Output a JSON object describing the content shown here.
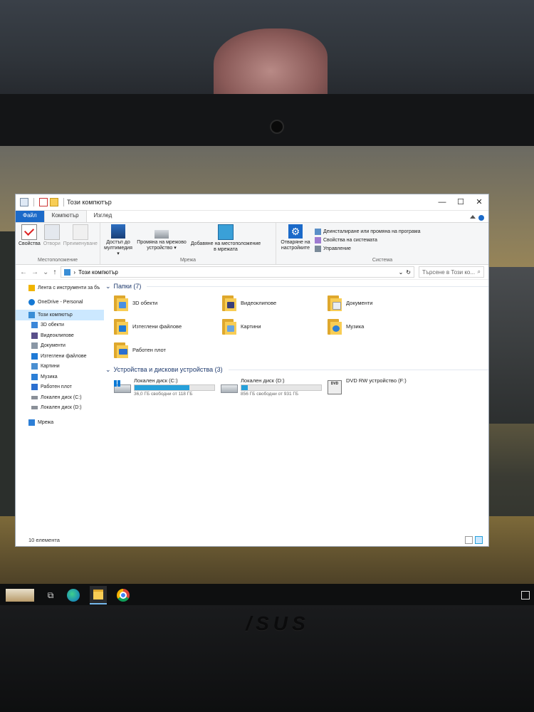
{
  "window": {
    "title": "Този компютър",
    "controls": {
      "minimize": "—",
      "maximize": "☐",
      "close": "✕"
    }
  },
  "tabs": [
    {
      "label": "Файл"
    },
    {
      "label": "Компютър"
    },
    {
      "label": "Изглед"
    }
  ],
  "ribbon": {
    "location_group": {
      "label": "Местоположение",
      "buttons": [
        "Свойства",
        "Отвори",
        "Преименуване"
      ]
    },
    "network_group": {
      "label": "Мрежа",
      "buttons": [
        "Достъп до мултимедия ▾",
        "Промяна на мрежово устройство ▾",
        "Добавяне на местоположение в мрежата"
      ]
    },
    "settings_button": "Отваряне на настройките",
    "system_group": {
      "label": "Система",
      "items": [
        "Деинсталиране или промяна на програма",
        "Свойства на системата",
        "Управление"
      ]
    }
  },
  "address": {
    "back": "←",
    "forward": "→",
    "recent": "⌄",
    "up": "↑",
    "path": "Този компютър",
    "refresh": "↻",
    "search_placeholder": "Търсене в Този ко..."
  },
  "nav_pane": [
    {
      "label": "Лента с инструменти за бъ",
      "icon": "star-icon",
      "color": "#f0b400"
    },
    {
      "label": "OneDrive - Personal",
      "icon": "cloud-icon",
      "color": "#1478d4"
    },
    {
      "label": "Този компютър",
      "icon": "computer-icon",
      "color": "#3a8ed6",
      "selected": true
    },
    {
      "label": "3D обекти",
      "icon": "cube-icon",
      "color": "#3b87d9"
    },
    {
      "label": "Видеоклипове",
      "icon": "video-icon",
      "color": "#5a4f8a"
    },
    {
      "label": "Документи",
      "icon": "document-icon",
      "color": "#8a97a6"
    },
    {
      "label": "Изтеглени файлове",
      "icon": "download-icon",
      "color": "#1f7ad6"
    },
    {
      "label": "Картини",
      "icon": "picture-icon",
      "color": "#4a8fd1"
    },
    {
      "label": "Музика",
      "icon": "music-icon",
      "color": "#2c7fd6"
    },
    {
      "label": "Работен плот",
      "icon": "desktop-icon",
      "color": "#2b6fd0"
    },
    {
      "label": "Локален диск (C:)",
      "icon": "drive-icon",
      "color": "#8a9098"
    },
    {
      "label": "Локален диск (D:)",
      "icon": "drive-icon",
      "color": "#8a9098"
    },
    {
      "label": "Мрежа",
      "icon": "network-icon",
      "color": "#2d7fd6"
    }
  ],
  "folders_group": {
    "title": "Папки (7)"
  },
  "folders": [
    {
      "label": "3D обекти",
      "badge": "#4a90e2"
    },
    {
      "label": "Видеоклипове",
      "badge": "#3a3f7a"
    },
    {
      "label": "Документи",
      "badge": "#e9eef3"
    },
    {
      "label": "Изтеглени файлове",
      "badge": "#1f7ad6"
    },
    {
      "label": "Картини",
      "badge": "#6aa5e0"
    },
    {
      "label": "Музика",
      "badge": "#2c7fd6"
    },
    {
      "label": "Работен плот",
      "badge": "#2b6fd0"
    }
  ],
  "devices_group": {
    "title": "Устройства и дискови устройства (3)"
  },
  "devices": [
    {
      "name": "Локален диск (C:)",
      "free": "36,0 ГБ свободни от 118 ГБ",
      "used_fraction": 0.69
    },
    {
      "name": "Локален диск (D:)",
      "free": "856 ГБ свободни от 931 ГБ",
      "used_fraction": 0.08
    },
    {
      "name": "DVD RW устройство (F:)",
      "dvd_label": "DVD"
    }
  ],
  "status": {
    "items": "10 елемента"
  },
  "brand": "/SUS",
  "colors": {
    "accent": "#1b6ac9",
    "selection": "#cce8ff",
    "folder": "#f8cd55",
    "progress": "#26a0da"
  }
}
